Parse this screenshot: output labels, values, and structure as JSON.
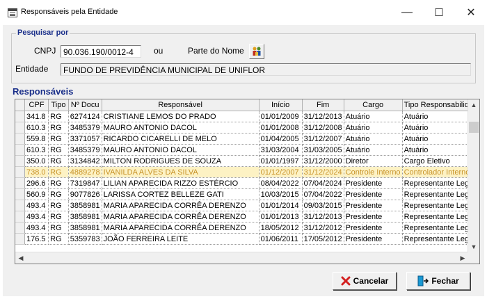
{
  "window": {
    "title": "Responsáveis pela Entidade",
    "minimize": "—",
    "maximize": "☐",
    "close": "✕"
  },
  "search": {
    "group_label": "Pesquisar por",
    "cnpj_label": "CNPJ",
    "cnpj_value": "90.036.190/0012-4",
    "or_label": "ou",
    "name_part_label": "Parte do Nome",
    "entity_label": "Entidade",
    "entity_value": "FUNDO DE PREVIDÊNCIA MUNICIPAL DE UNIFLOR"
  },
  "grid": {
    "section_title": "Responsáveis",
    "columns": [
      "CPF",
      "Tipo",
      "Nº Docu",
      "Responsável",
      "Início",
      "Fim",
      "Cargo",
      "Tipo Responsabilidad"
    ],
    "rows": [
      {
        "cpf": "341.8",
        "tipo": "RG",
        "doc": "6274124",
        "resp": "CRISTIANE LEMOS DO PRADO",
        "inicio": "01/01/2009",
        "fim": "31/12/2013",
        "cargo": "Atuário",
        "tipo_resp": "Atuário"
      },
      {
        "cpf": "610.3",
        "tipo": "RG",
        "doc": "3485379",
        "resp": "MAURO ANTONIO DACOL",
        "inicio": "01/01/2008",
        "fim": "31/12/2008",
        "cargo": "Atuário",
        "tipo_resp": "Atuário"
      },
      {
        "cpf": "559.8",
        "tipo": "RG",
        "doc": "3371057",
        "resp": "RICARDO CICARELLI DE MELO",
        "inicio": "01/04/2005",
        "fim": "31/12/2007",
        "cargo": "Atuário",
        "tipo_resp": "Atuário"
      },
      {
        "cpf": "610.3",
        "tipo": "RG",
        "doc": "3485379",
        "resp": "MAURO ANTONIO DACOL",
        "inicio": "31/03/2004",
        "fim": "31/03/2005",
        "cargo": "Atuário",
        "tipo_resp": "Atuário"
      },
      {
        "cpf": "350.0",
        "tipo": "RG",
        "doc": "3134842",
        "resp": "MILTON RODRIGUES DE SOUZA",
        "inicio": "01/01/1997",
        "fim": "31/12/2000",
        "cargo": "Diretor",
        "tipo_resp": "Cargo Eletivo"
      },
      {
        "cpf": "738.0",
        "tipo": "RG",
        "doc": "4889278",
        "resp": "IVANILDA ALVES DA SILVA",
        "inicio": "01/12/2007",
        "fim": "31/12/2024",
        "cargo": "Controle Interno",
        "tipo_resp": "Controlador Interno",
        "selected": true
      },
      {
        "cpf": "296.6",
        "tipo": "RG",
        "doc": "7319847",
        "resp": "LILIAN APARECIDA RIZZO ESTÉRCIO",
        "inicio": "08/04/2022",
        "fim": "07/04/2024",
        "cargo": "Presidente",
        "tipo_resp": "Representante Legal"
      },
      {
        "cpf": "560.9",
        "tipo": "RG",
        "doc": "9077826",
        "resp": "LARISSA CORTEZ BELLEZE GATI",
        "inicio": "10/03/2015",
        "fim": "07/04/2022",
        "cargo": "Presidente",
        "tipo_resp": "Representante Legal"
      },
      {
        "cpf": "493.4",
        "tipo": "RG",
        "doc": "3858981",
        "resp": "MARIA APARECIDA CORRÊA DERENZO",
        "inicio": "01/01/2014",
        "fim": "09/03/2015",
        "cargo": "Presidente",
        "tipo_resp": "Representante Legal"
      },
      {
        "cpf": "493.4",
        "tipo": "RG",
        "doc": "3858981",
        "resp": "MARIA APARECIDA CORRÊA DERENZO",
        "inicio": "01/01/2013",
        "fim": "31/12/2013",
        "cargo": "Presidente",
        "tipo_resp": "Representante Legal"
      },
      {
        "cpf": "493.4",
        "tipo": "RG",
        "doc": "3858981",
        "resp": "MARIA APARECIDA CORRÊA DERENZO",
        "inicio": "18/05/2012",
        "fim": "31/12/2012",
        "cargo": "Presidente",
        "tipo_resp": "Representante Legal"
      },
      {
        "cpf": "176.5",
        "tipo": "RG",
        "doc": "5359783",
        "resp": "JOÃO FERREIRA LEITE",
        "inicio": "01/06/2011",
        "fim": "17/05/2012",
        "cargo": "Presidente",
        "tipo_resp": "Representante Legal"
      }
    ]
  },
  "buttons": {
    "cancel": "Cancelar",
    "close": "Fechar"
  },
  "colors": {
    "accent": "#1a2f8a",
    "selected_row_bg": "#fdf2c4",
    "selected_row_text": "#c8932a",
    "cancel_icon": "#d42020",
    "close_icon": "#1a9ad4"
  },
  "icons": {
    "app": "form-window-icon",
    "search": "search-people-icon",
    "cancel": "red-x-icon",
    "close": "exit-door-icon"
  }
}
